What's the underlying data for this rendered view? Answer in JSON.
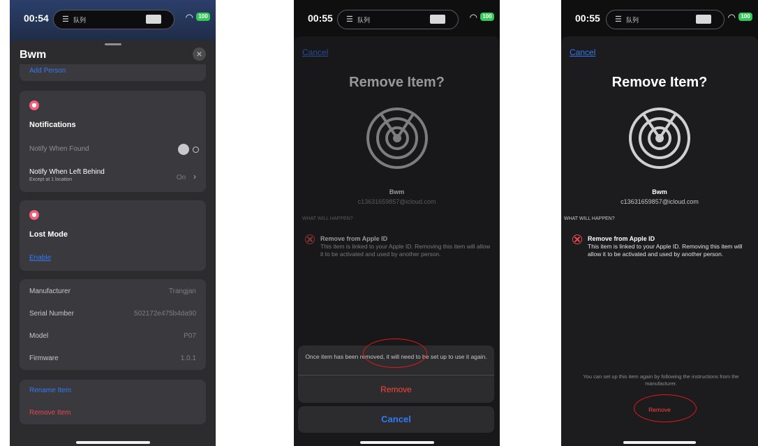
{
  "screen1": {
    "time": "00:54",
    "island_label": "队列",
    "battery": "100",
    "title": "Bwm",
    "add_person": "Add Person",
    "notifications": {
      "heading": "Notifications",
      "notify_found": "Notify When Found",
      "notify_left": "Notify When Left Behind",
      "notify_left_sub": "Except at 1 location",
      "notify_left_value": "On"
    },
    "lost_mode": {
      "heading": "Lost Mode",
      "enable": "Enable"
    },
    "info": [
      {
        "label": "Manufacturer",
        "value": "Trangjan"
      },
      {
        "label": "Serial Number",
        "value": "502172e475b4da90"
      },
      {
        "label": "Model",
        "value": "P07"
      },
      {
        "label": "Firmware",
        "value": "1.0.1"
      }
    ],
    "rename": "Rename Item",
    "remove": "Remove Item"
  },
  "screen2": {
    "time": "00:55",
    "island_label": "队列",
    "battery": "100",
    "cancel_link": "Cancel",
    "title": "Remove Item?",
    "item_name": "Bwm",
    "item_email": "c13631659857@icloud.com",
    "what_will_happen": "WHAT WILL HAPPEN?",
    "remove_title": "Remove from Apple ID",
    "remove_desc": "This item is linked to your Apple ID. Removing this item will allow it to be activated and used by another person.",
    "action_msg": "Once item has been removed, it will need to be set up to use it again.",
    "action_remove": "Remove",
    "action_cancel": "Cancel"
  },
  "screen3": {
    "time": "00:55",
    "island_label": "队列",
    "battery": "100",
    "cancel_link": "Cancel",
    "title": "Remove Item?",
    "item_name": "Bwm",
    "item_email": "c13631659857@icloud.com",
    "what_will_happen": "WHAT WILL HAPPEN?",
    "remove_title": "Remove from Apple ID",
    "remove_desc": "This item is linked to your Apple ID. Removing this item will allow it to be activated and used by another person.",
    "footnote": "You can set up this item again by following the instructions from the manufacturer.",
    "remove": "Remove"
  },
  "colors": {
    "link": "#3478f6",
    "danger": "#ff453a",
    "annotation": "#e01a1a",
    "battery": "#35c759"
  }
}
